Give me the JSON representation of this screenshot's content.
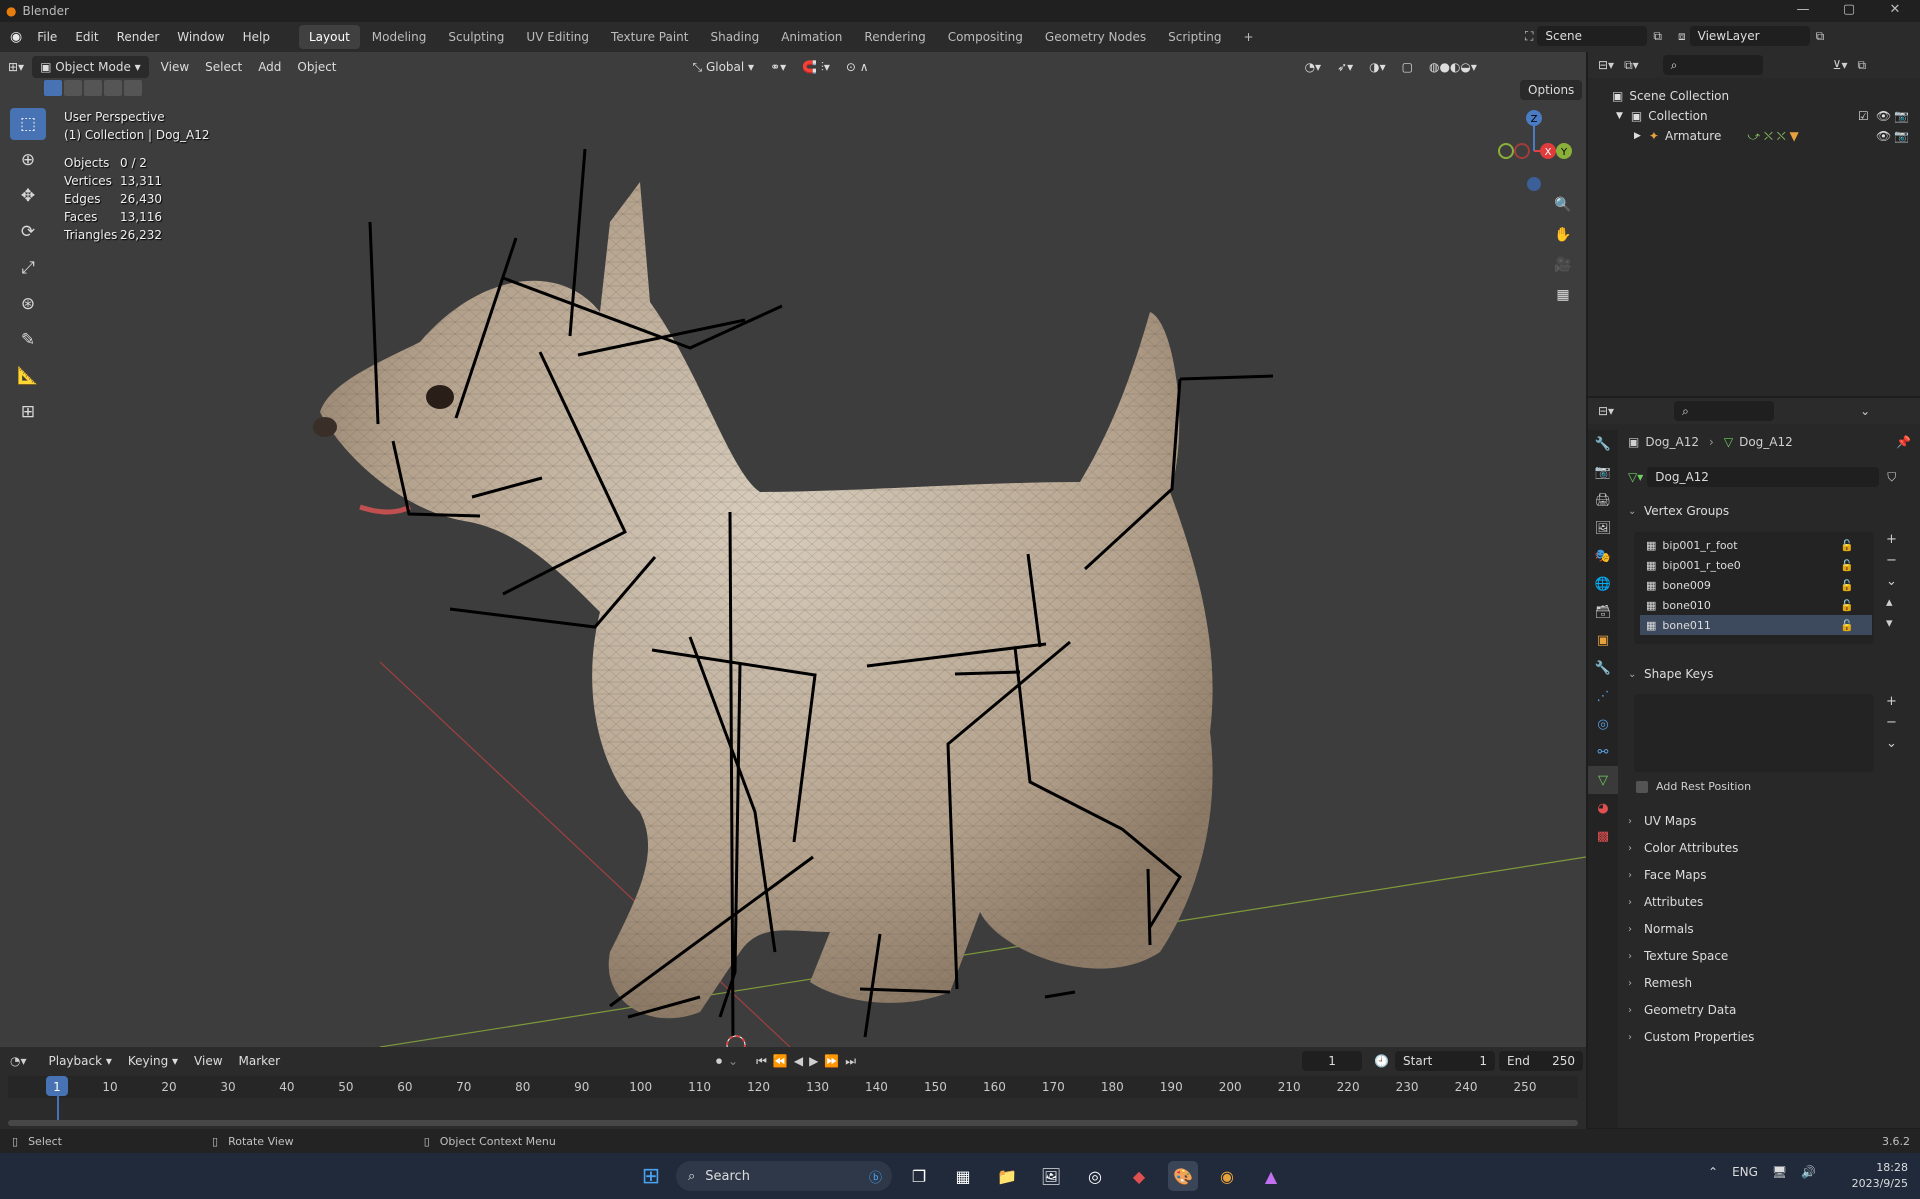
{
  "window": {
    "title": "Blender",
    "minimize": "—",
    "maximize": "▢",
    "close": "✕"
  },
  "menu": [
    "File",
    "Edit",
    "Render",
    "Window",
    "Help"
  ],
  "workspaces": [
    "Layout",
    "Modeling",
    "Sculpting",
    "UV Editing",
    "Texture Paint",
    "Shading",
    "Animation",
    "Rendering",
    "Compositing",
    "Geometry Nodes",
    "Scripting"
  ],
  "workspace_add": "+",
  "scene": {
    "name": "Scene",
    "view_layer": "ViewLayer"
  },
  "viewport_header": {
    "mode": "Object Mode",
    "view": "View",
    "select": "Select",
    "add": "Add",
    "object": "Object",
    "orientation": "Global",
    "options": "Options"
  },
  "overlay": {
    "perspective": "User Perspective",
    "collection_info": "(1) Collection | Dog_A12",
    "stats": [
      {
        "label": "Objects",
        "value": "0 / 2"
      },
      {
        "label": "Vertices",
        "value": "13,311"
      },
      {
        "label": "Edges",
        "value": "26,430"
      },
      {
        "label": "Faces",
        "value": "13,116"
      },
      {
        "label": "Triangles",
        "value": "26,232"
      }
    ]
  },
  "gizmo": {
    "z": "Z",
    "y": "Y",
    "x": "X"
  },
  "outliner": {
    "scene_collection": "Scene Collection",
    "collection": "Collection",
    "armature": "Armature"
  },
  "properties": {
    "breadcrumb_object": "Dog_A12",
    "breadcrumb_data": "Dog_A12",
    "mesh_name": "Dog_A12",
    "vertex_groups_title": "Vertex Groups",
    "vertex_groups": [
      "bip001_r_foot",
      "bip001_r_toe0",
      "bone009",
      "bone010",
      "bone011"
    ],
    "shape_keys_title": "Shape Keys",
    "add_rest_position": "Add Rest Position",
    "panels": [
      "UV Maps",
      "Color Attributes",
      "Face Maps",
      "Attributes",
      "Normals",
      "Texture Space",
      "Remesh",
      "Geometry Data",
      "Custom Properties"
    ]
  },
  "timeline": {
    "playback": "Playback",
    "keying": "Keying",
    "view": "View",
    "marker": "Marker",
    "current_frame": "1",
    "start_label": "Start",
    "start": "1",
    "end_label": "End",
    "end": "250",
    "ticks": [
      "1",
      "10",
      "20",
      "30",
      "40",
      "50",
      "60",
      "70",
      "80",
      "90",
      "100",
      "110",
      "120",
      "130",
      "140",
      "150",
      "160",
      "170",
      "180",
      "190",
      "200",
      "210",
      "220",
      "230",
      "240",
      "250"
    ]
  },
  "status": {
    "select": "Select",
    "rotate": "Rotate View",
    "context": "Object Context Menu",
    "version": "3.6.2"
  },
  "taskbar": {
    "search": "Search",
    "lang": "ENG",
    "time": "18:28",
    "date": "2023/9/25"
  },
  "colors": {
    "accent": "#4772b3",
    "viewport": "#3d3d3d",
    "panel": "#282828",
    "bone": "#000000",
    "mesh": "#b8aa98"
  }
}
